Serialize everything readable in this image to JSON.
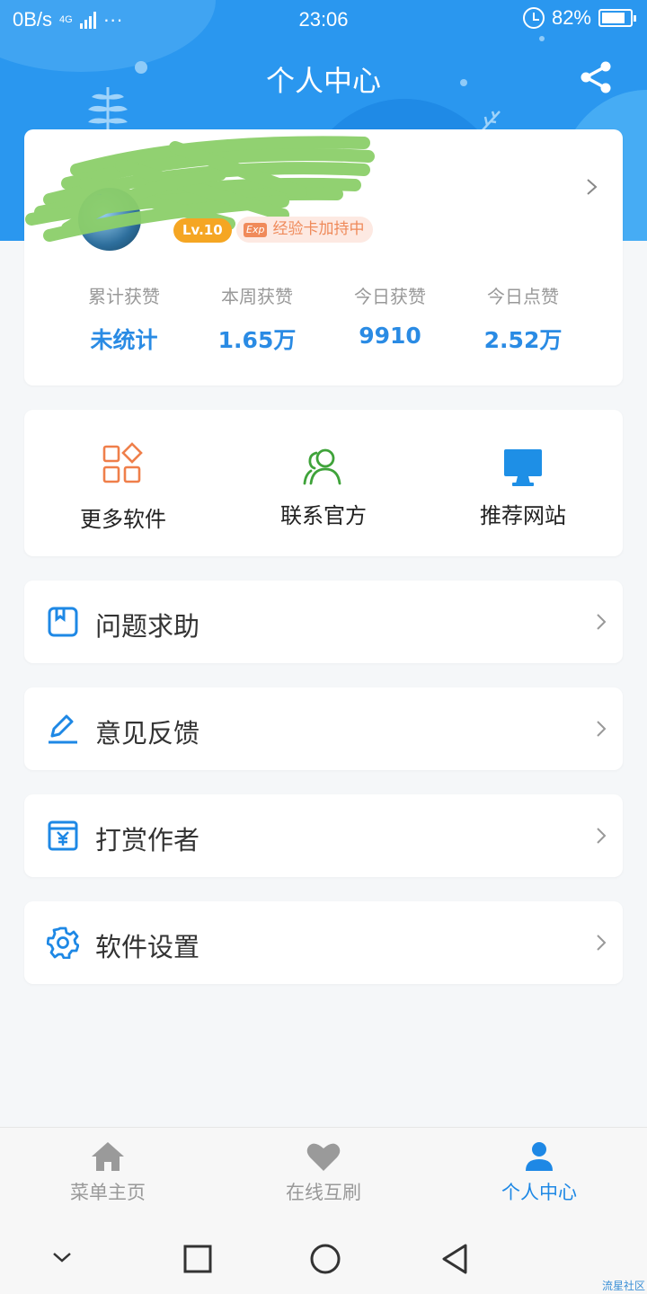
{
  "status_bar": {
    "net_speed": "0B/s",
    "network_type": "4G",
    "more_dots": "···",
    "time": "23:06",
    "battery_percent": "82%",
    "battery_level": 0.82
  },
  "header": {
    "title": "个人中心"
  },
  "profile": {
    "level": "Lv.10",
    "exp_tag": "Exp",
    "exp_text": "经验卡加持中",
    "stats": [
      {
        "label": "累计获赞",
        "value": "未统计"
      },
      {
        "label": "本周获赞",
        "value": "1.65万"
      },
      {
        "label": "今日获赞",
        "value": "9910"
      },
      {
        "label": "今日点赞",
        "value": "2.52万"
      }
    ]
  },
  "quick_actions": [
    {
      "label": "更多软件",
      "icon": "grid-apps-icon"
    },
    {
      "label": "联系官方",
      "icon": "users-icon"
    },
    {
      "label": "推荐网站",
      "icon": "monitor-icon"
    }
  ],
  "menu": [
    {
      "label": "问题求助",
      "icon": "bookmark-box-icon"
    },
    {
      "label": "意见反馈",
      "icon": "edit-pen-icon"
    },
    {
      "label": "打赏作者",
      "icon": "yuan-calendar-icon"
    },
    {
      "label": "软件设置",
      "icon": "gear-icon"
    }
  ],
  "bottom_nav": [
    {
      "label": "菜单主页",
      "icon": "home-icon",
      "active": false
    },
    {
      "label": "在线互刷",
      "icon": "heart-icon",
      "active": false
    },
    {
      "label": "个人中心",
      "icon": "person-icon",
      "active": true
    }
  ],
  "watermark": "流星社区",
  "colors": {
    "accent": "#2a97ef",
    "active_tab": "#1e88e5",
    "stat_value": "#2a8be4",
    "level_badge": "#f5a623"
  }
}
